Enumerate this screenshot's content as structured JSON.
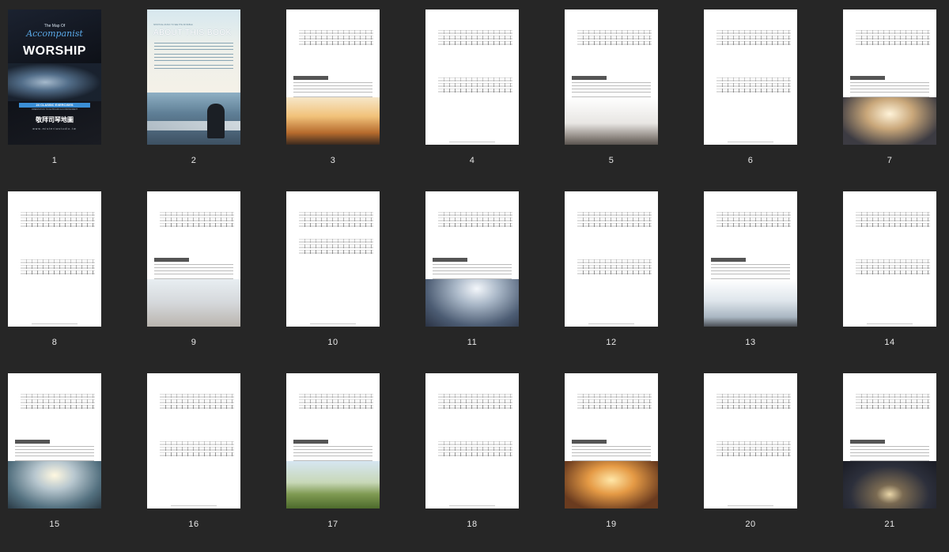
{
  "pages": [
    {
      "label": "1",
      "kind": "cover",
      "cover": {
        "map_of": "The Map Of",
        "accompanist": "Accompanist",
        "worship": "WORSHIP",
        "band": "24 CLASSIC EXERCISES",
        "sub": "ORIENTATION TO KEYBOARD ACCOMPANIMENT",
        "zh_title": "敬拜司琴地圖",
        "site": "www.misteriastudio.tw"
      }
    },
    {
      "label": "2",
      "kind": "about",
      "about": {
        "small": "SPIRITUAL MUSIC TO SEE THE INVISIBLE",
        "title": "ABOUT THIS BOOK"
      }
    },
    {
      "label": "3",
      "kind": "score-photo",
      "photo": "sunset"
    },
    {
      "label": "4",
      "kind": "score"
    },
    {
      "label": "5",
      "kind": "score-photo",
      "photo": "chapel"
    },
    {
      "label": "6",
      "kind": "score"
    },
    {
      "label": "7",
      "kind": "score-photo",
      "photo": "hands-light"
    },
    {
      "label": "8",
      "kind": "score"
    },
    {
      "label": "9",
      "kind": "score-photo",
      "photo": "woman-white"
    },
    {
      "label": "10",
      "kind": "score-short"
    },
    {
      "label": "11",
      "kind": "score-photo",
      "photo": "sunrays-clouds"
    },
    {
      "label": "12",
      "kind": "score"
    },
    {
      "label": "13",
      "kind": "score-photo",
      "photo": "raised-arms"
    },
    {
      "label": "14",
      "kind": "score"
    },
    {
      "label": "15",
      "kind": "score-photo",
      "photo": "ocean-light"
    },
    {
      "label": "16",
      "kind": "score"
    },
    {
      "label": "17",
      "kind": "score-photo",
      "photo": "church-field"
    },
    {
      "label": "18",
      "kind": "score"
    },
    {
      "label": "19",
      "kind": "score-photo",
      "photo": "cross-sunset"
    },
    {
      "label": "20",
      "kind": "score"
    },
    {
      "label": "21",
      "kind": "score-photo",
      "photo": "open-bible"
    }
  ],
  "photo_colors": {
    "sunset": "#e9a256",
    "chapel": "#b9b6b2",
    "hands-light": "#8a7a68",
    "woman-white": "#c9c7c4",
    "sunrays-clouds": "#6d7f95",
    "raised-arms": "#d8dde2",
    "ocean-light": "#6b8393",
    "church-field": "#8aa261",
    "cross-sunset": "#d88a3a",
    "open-bible": "#2c2f3b"
  }
}
